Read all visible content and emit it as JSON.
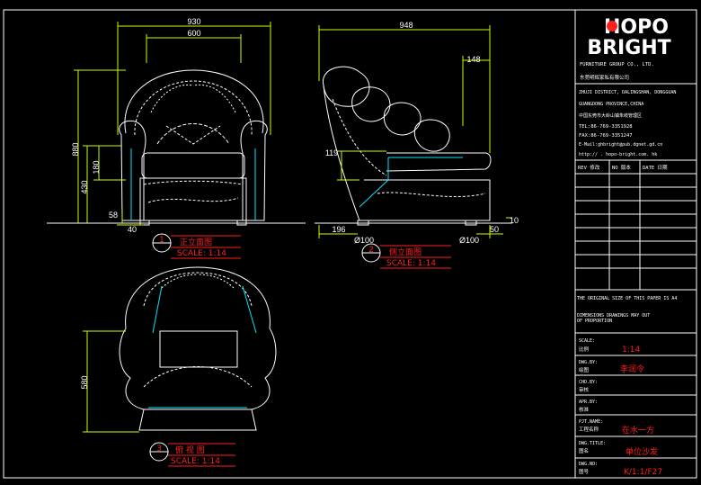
{
  "front_view": {
    "dims": {
      "overall_width": "930",
      "arm_width": "600",
      "height": "880",
      "seat_height": "430",
      "arm_height": "180",
      "bottom": "58",
      "leg": "40"
    },
    "caption_no": "1",
    "caption_title": "正立面图",
    "caption_scale": "SCALE: 1:14"
  },
  "side_view": {
    "dims": {
      "depth": "948",
      "back_top": "148",
      "seat": "119",
      "front_offset": "196",
      "leg_left": "Ø100",
      "leg_right": "Ø100",
      "right_offset": "50",
      "small": "10"
    },
    "caption_no": "2",
    "caption_title": "侧立面图",
    "caption_scale": "SCALE: 1:14"
  },
  "top_view": {
    "dims": {
      "depth": "580"
    },
    "caption_no": "3",
    "caption_title": "俯 视 图",
    "caption_scale": "SCALE: 1:14"
  },
  "title_block": {
    "logo_top": "HOPO",
    "logo_bottom": "BRIGHT",
    "company_en": "FURNITURE GROUP CO., LTD.",
    "company_cn": "东莞明辉家私有限公司",
    "addr1": "ZHUJI DISTRICT, DALINGSHAN, DONGGUAN",
    "addr2": "GUANGDONG PROVINCE,CHINA",
    "addr_cn": "中国东莞市大岭山镇朱岐管理区",
    "tel": "TEL:86-769-3351928",
    "fax": "FAX:86-769-3351247",
    "email": "E-Mail:ghbright@pub.dgnet.gd.cn",
    "web": "http:// . hopo-bright.com. hk",
    "rev_head": [
      "REV 修改",
      "NO 版本",
      "DATE 日期"
    ],
    "note1": "THE ORIGINAL SIZE OF THIS  PAPER IS A4",
    "note2": "DIMENSIONS DRAWINGS MAY OUT",
    "note3": "OF PROPORTION",
    "scale_label_en": "SCALE:",
    "scale_label_cn": "比例",
    "scale_value": "1:14",
    "dwg_by_en": "DWG.BY:",
    "dwg_by_cn": "绘图",
    "dwg_by_value": "李润令",
    "chd_by_en": "CHD.BY:",
    "chd_by_cn": "审核",
    "apr_by_en": "APR.BY:",
    "apr_by_cn": "核准",
    "pjt_en": "PJT.NAME:",
    "pjt_cn": "工程名称",
    "pjt_value": "在水一方",
    "title_en": "DWG.TITLE:",
    "title_cn": "图名",
    "title_value": "单位沙发",
    "no_en": "DWG.NO:",
    "no_cn": "图号",
    "no_value": "K/1:1/F27"
  },
  "colors": {
    "background": "#000000",
    "line": "#ffffff",
    "dimension": "#c8ff00",
    "accent": "#00e5ff",
    "annotation": "#ff2020"
  }
}
